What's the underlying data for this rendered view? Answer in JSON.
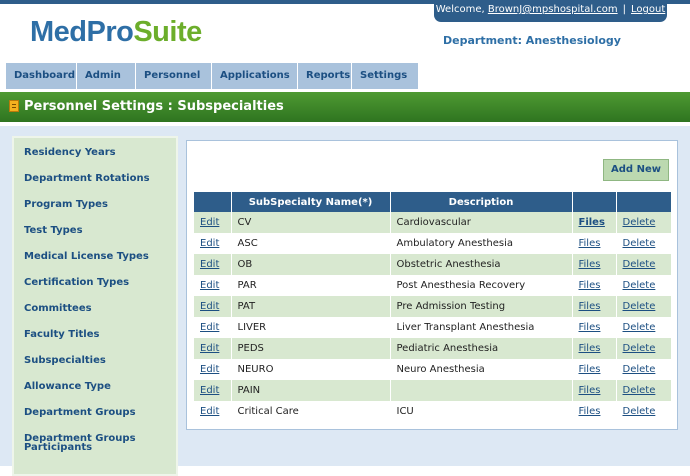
{
  "app": {
    "logo_part1": "MedPro",
    "logo_part2": "Suite"
  },
  "header": {
    "welcome_prefix": "Welcome,",
    "user_email": "BrownJ@mpshospital.com",
    "separator": "|",
    "logout_label": "Logout",
    "department": "Department: Anesthesiology"
  },
  "nav": {
    "tabs": [
      {
        "label": "Dashboard"
      },
      {
        "label": "Admin"
      },
      {
        "label": "Personnel"
      },
      {
        "label": "Applications"
      },
      {
        "label": "Reports"
      },
      {
        "label": "Settings"
      }
    ]
  },
  "page": {
    "title": "Personnel Settings : Subspecialties"
  },
  "sidebar": {
    "items": [
      {
        "label": "Residency Years"
      },
      {
        "label": "Department Rotations"
      },
      {
        "label": "Program Types"
      },
      {
        "label": "Test Types"
      },
      {
        "label": "Medical License Types"
      },
      {
        "label": "Certification Types"
      },
      {
        "label": "Committees"
      },
      {
        "label": "Faculty Titles"
      },
      {
        "label": "Subspecialties"
      },
      {
        "label": "Allowance Type"
      },
      {
        "label": "Department Groups"
      },
      {
        "label": "Department Groups Participants"
      }
    ]
  },
  "toolbar": {
    "add_new_label": "Add New"
  },
  "table": {
    "columns": [
      "",
      "SubSpecialty Name(*)",
      "Description",
      "",
      ""
    ],
    "edit_label": "Edit",
    "files_label": "Files",
    "delete_label": "Delete",
    "rows": [
      {
        "name": "CV",
        "description": "Cardiovascular"
      },
      {
        "name": "ASC",
        "description": "Ambulatory Anesthesia"
      },
      {
        "name": "OB",
        "description": "Obstetric Anesthesia"
      },
      {
        "name": "PAR",
        "description": "Post Anesthesia Recovery"
      },
      {
        "name": "PAT",
        "description": "Pre Admission Testing"
      },
      {
        "name": "LIVER",
        "description": "Liver Transplant Anesthesia"
      },
      {
        "name": "PEDS",
        "description": "Pediatric Anesthesia"
      },
      {
        "name": "NEURO",
        "description": "Neuro Anesthesia"
      },
      {
        "name": "PAIN",
        "description": ""
      },
      {
        "name": "Critical Care",
        "description": "ICU"
      }
    ]
  },
  "colors": {
    "nav_tab_bg": "#a9c2dc",
    "header_green": "#3c8a2a",
    "table_header": "#2e5d8a",
    "row_alt": "#d8e8d0",
    "sidebar_bg": "#d8e8d0",
    "content_bg": "#dde8f4"
  },
  "icons": {
    "page_header_icon": "document-icon"
  }
}
